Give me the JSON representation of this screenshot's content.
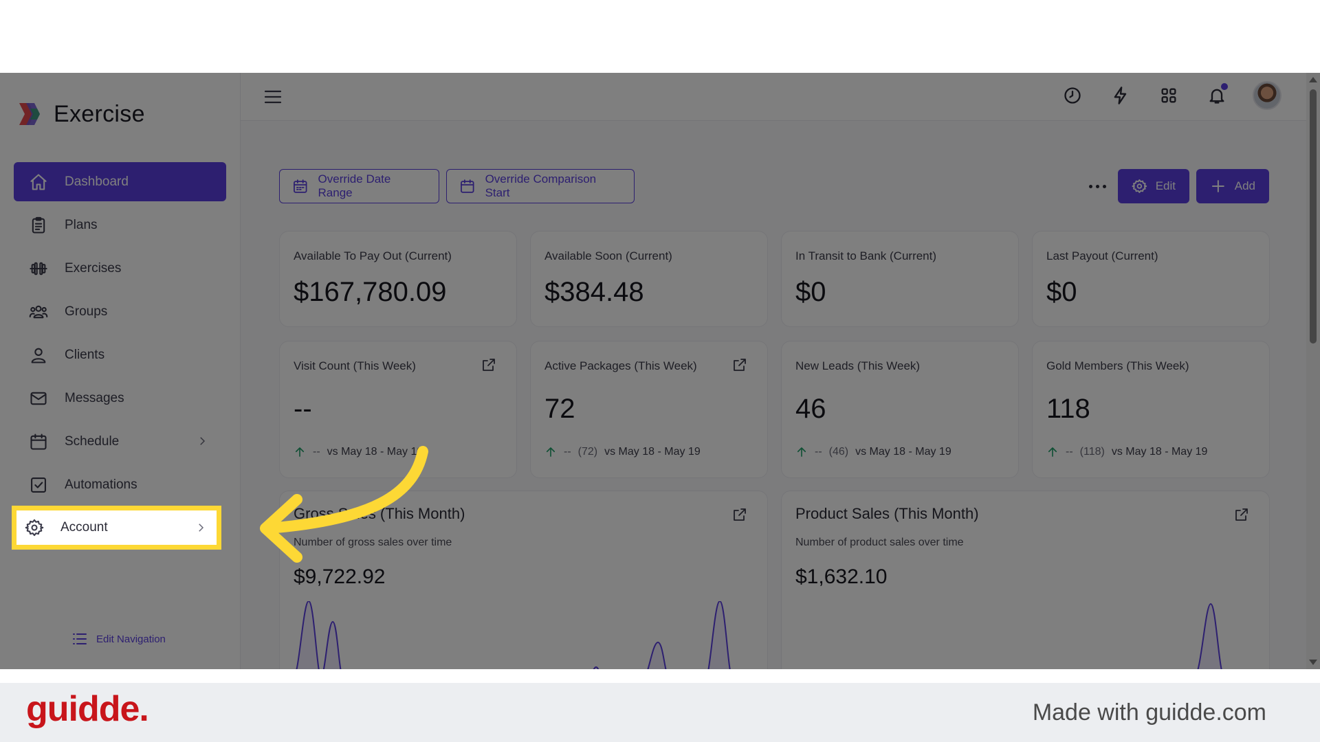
{
  "brand": {
    "name": "Exercise"
  },
  "sidebar": {
    "items": [
      {
        "label": "Dashboard",
        "icon": "home-icon",
        "active": true
      },
      {
        "label": "Plans",
        "icon": "clipboard-icon"
      },
      {
        "label": "Exercises",
        "icon": "dumbbell-icon"
      },
      {
        "label": "Groups",
        "icon": "users-icon"
      },
      {
        "label": "Clients",
        "icon": "user-icon"
      },
      {
        "label": "Messages",
        "icon": "mail-icon"
      },
      {
        "label": "Schedule",
        "icon": "calendar-icon",
        "has_children": true
      },
      {
        "label": "Automations",
        "icon": "checkbox-icon"
      },
      {
        "label": "Account",
        "icon": "gear-icon",
        "has_children": true,
        "highlighted": true
      }
    ],
    "edit_navigation": "Edit Navigation"
  },
  "toolbar": {
    "override_date_range": "Override Date Range",
    "override_comparison_start": "Override Comparison Start",
    "edit": "Edit",
    "add": "Add"
  },
  "stats_row1": [
    {
      "label": "Available To Pay Out (Current)",
      "value": "$167,780.09"
    },
    {
      "label": "Available Soon (Current)",
      "value": "$384.48"
    },
    {
      "label": "In Transit to Bank (Current)",
      "value": "$0"
    },
    {
      "label": "Last Payout (Current)",
      "value": "$0"
    }
  ],
  "stats_row2": [
    {
      "label": "Visit Count (This Week)",
      "value": "--",
      "delta": "--",
      "prev": "",
      "compare": "vs May 18 - May 19"
    },
    {
      "label": "Active Packages (This Week)",
      "value": "72",
      "delta": "--",
      "prev": "(72)",
      "compare": "vs May 18 - May 19"
    },
    {
      "label": "New Leads (This Week)",
      "value": "46",
      "delta": "--",
      "prev": "(46)",
      "compare": "vs May 18 - May 19"
    },
    {
      "label": "Gold Members (This Week)",
      "value": "118",
      "delta": "--",
      "prev": "(118)",
      "compare": "vs May 18 - May 19"
    }
  ],
  "charts": [
    {
      "title": "Gross Sales (This Month)",
      "subtitle": "Number of gross sales over time",
      "value": "$9,722.92"
    },
    {
      "title": "Product Sales (This Month)",
      "subtitle": "Number of product sales over time",
      "value": "$1,632.10"
    }
  ],
  "footer": {
    "logo": "guidde.",
    "made_with": "Made with guidde.com"
  },
  "colors": {
    "accent": "#5a3fe0",
    "highlight": "#fdd835",
    "positive": "#22a06b",
    "footer_logo": "#c8151b"
  }
}
